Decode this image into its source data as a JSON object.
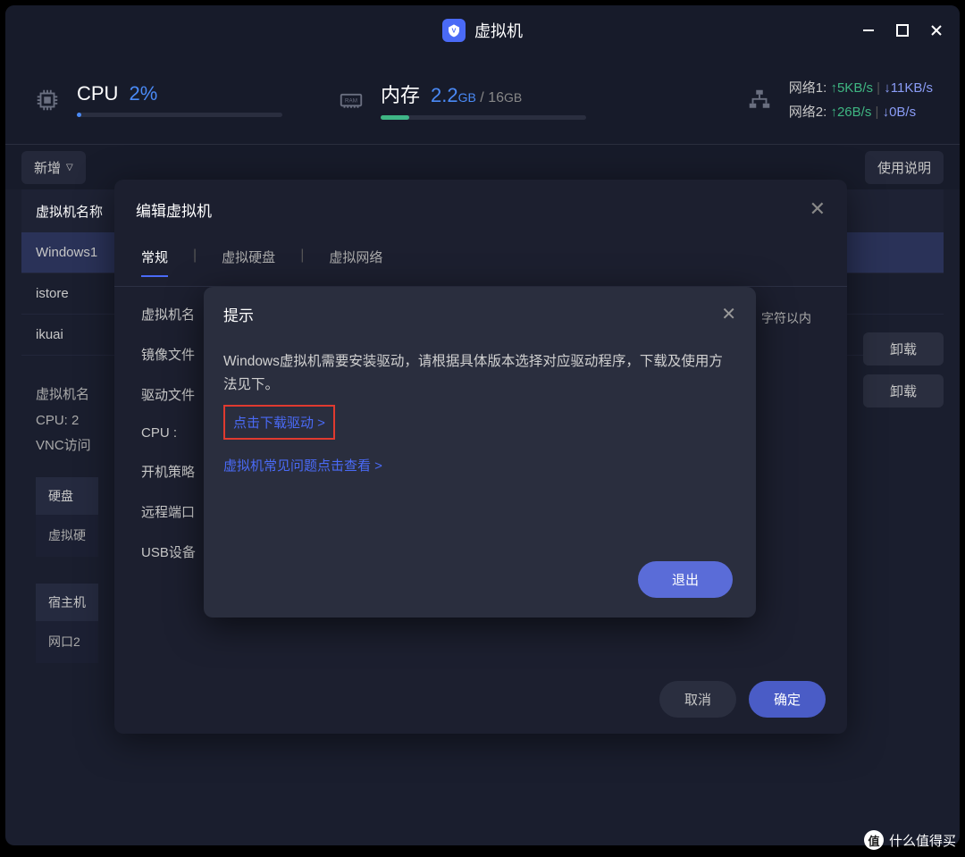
{
  "title": "虚拟机",
  "stats": {
    "cpu_label": "CPU",
    "cpu_val": "2%",
    "mem_label": "内存",
    "mem_val": "2.2",
    "mem_unit": "GB",
    "mem_total": "16",
    "mem_total_unit": "GB",
    "net1_label": "网络1:",
    "net1_up": "↑5KB/s",
    "net1_dn": "↓11KB/s",
    "net2_label": "网络2:",
    "net2_up": "↑26B/s",
    "net2_dn": "↓0B/s"
  },
  "toolbar": {
    "add": "新增",
    "help": "使用说明"
  },
  "table": {
    "header_name": "虚拟机名称",
    "rows": [
      "Windows1",
      "istore",
      "ikuai"
    ]
  },
  "detail": {
    "l1": "虚拟机名",
    "l2": "CPU:  2",
    "l3": "VNC访问",
    "hd_head": "硬盘",
    "hd_row": "虚拟硬",
    "host_head": "宿主机",
    "host_row": "网口2"
  },
  "right_btns": [
    "卸载",
    "卸载"
  ],
  "modal1": {
    "title": "编辑虚拟机",
    "tabs": [
      "常规",
      "虚拟硬盘",
      "虚拟网络"
    ],
    "rows": [
      "虚拟机名",
      "镜像文件",
      "驱动文件",
      "CPU :",
      "开机策略",
      "远程端口",
      "USB设备"
    ],
    "side_hint": "字符以内",
    "cancel": "取消",
    "ok": "确定"
  },
  "modal2": {
    "title": "提示",
    "text": "Windows虚拟机需要安装驱动，请根据具体版本选择对应驱动程序，下载及使用方法见下。",
    "link1": "点击下载驱动 >",
    "link2": "虚拟机常见问题点击查看 >",
    "exit": "退出"
  },
  "watermark": "什么值得买"
}
